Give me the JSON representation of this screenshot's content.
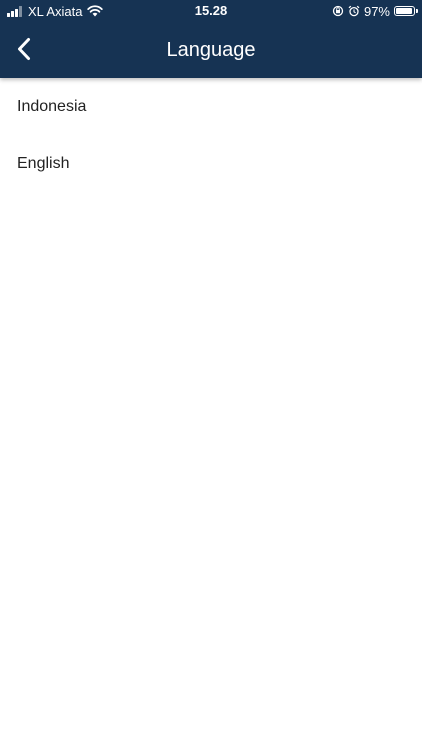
{
  "status_bar": {
    "carrier": "XL Axiata",
    "time": "15.28",
    "battery_percent": "97%",
    "battery_level": 0.97,
    "signal_bars_filled": 3,
    "signal_bars_total": 4
  },
  "header": {
    "title": "Language",
    "back_icon": "chevron-left-icon",
    "background_color": "#163353"
  },
  "languages": {
    "items": [
      {
        "label": "Indonesia"
      },
      {
        "label": "English"
      }
    ]
  }
}
